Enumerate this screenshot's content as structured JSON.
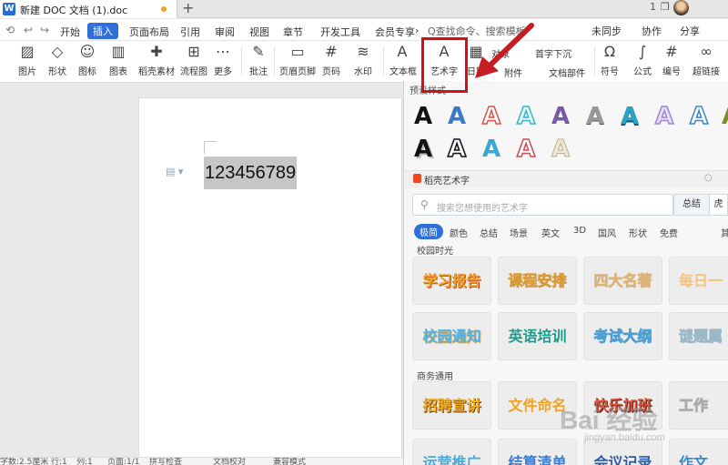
{
  "titlebar": {
    "doc_icon": "W",
    "doc_title": "新建 DOC 文档 (1).doc",
    "add_tab": "+",
    "right_icons": [
      "1",
      "❐"
    ]
  },
  "menu": {
    "quick_icons": [
      "⟲",
      "↩",
      "↪"
    ],
    "items": [
      "开始",
      "插入",
      "页面布局",
      "引用",
      "审阅",
      "视图",
      "章节",
      "开发工具",
      "会员专享"
    ],
    "more": "›",
    "search": "Q查找命令、搜索模板",
    "right": [
      "未同步",
      "协作",
      "分享"
    ]
  },
  "ribbon": {
    "big": [
      "图片",
      "形状",
      "图标",
      "图表",
      "稻壳素材",
      "流程图",
      "更多",
      "批注",
      "页眉页脚",
      "页码",
      "水印",
      "文本框",
      "艺术字",
      "日期",
      "符号",
      "公式",
      "编号",
      "超链接"
    ],
    "small": {
      "s1": "对象",
      "s2": "首字下沉",
      "s3": "附件",
      "s4": "文档部件"
    }
  },
  "document": {
    "text": "123456789"
  },
  "status": [
    "字数:2.5厘米",
    "行:1",
    "列:1",
    "页面:1/1",
    "拼写检查",
    "文档校对",
    "兼容模式"
  ],
  "panel": {
    "preset_label": "预设样式",
    "wordart_letter": "A",
    "daoke_title": "稻壳艺术字",
    "search_placeholder": "搜索您想使用的艺术字",
    "search_button": "总结",
    "search_button2": "虎",
    "filters": [
      "极简",
      "颜色",
      "总结",
      "场景",
      "英文",
      "3D",
      "国风",
      "形状",
      "免费",
      "其"
    ],
    "section1": "校园时光",
    "section2": "商务通用",
    "tiles_row1": [
      "学习报告",
      "课程安排",
      "四大名著",
      "每日一"
    ],
    "tiles_row2": [
      "校园通知",
      "英语培训",
      "考试大纲",
      "谜题属"
    ],
    "tiles_row3": [
      "招聘宣讲",
      "文件命名",
      "快乐加班",
      "工作"
    ],
    "tiles_row4": [
      "运营推广",
      "结算清单",
      "会议记录",
      "作文"
    ]
  },
  "watermark": {
    "main": "Bai 经验",
    "sub": "jingyan.baidu.com"
  },
  "colors": {
    "accent": "#2e6fd8",
    "highlight": "#d3101a",
    "arrow": "#c41e22"
  }
}
